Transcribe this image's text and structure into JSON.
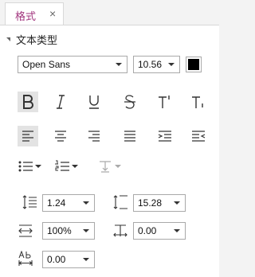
{
  "tab": {
    "label": "格式",
    "close_glyph": "×"
  },
  "section": {
    "title": "文本类型"
  },
  "font": {
    "family": "Open Sans",
    "size": "10.56",
    "color": "#000000"
  },
  "style_buttons": [
    "bold-icon",
    "italic-icon",
    "underline-icon",
    "strikethrough-icon",
    "superscript-icon",
    "subscript-icon"
  ],
  "align_buttons": [
    "align-left-icon",
    "align-center-icon",
    "align-right-icon",
    "justify-icon",
    "indent-increase-icon",
    "indent-decrease-icon"
  ],
  "active_align": "align-left",
  "list_buttons": [
    "bullet-list-icon",
    "numbered-list-icon",
    "text-direction-icon"
  ],
  "spacing": {
    "line_spacing": "1.24",
    "line_height": "15.28",
    "char_scale": "100%",
    "char_spacing": "0.00",
    "word_spacing": "0.00"
  },
  "colors": {
    "accent": "#a1347d",
    "border": "#a9a9a9"
  }
}
